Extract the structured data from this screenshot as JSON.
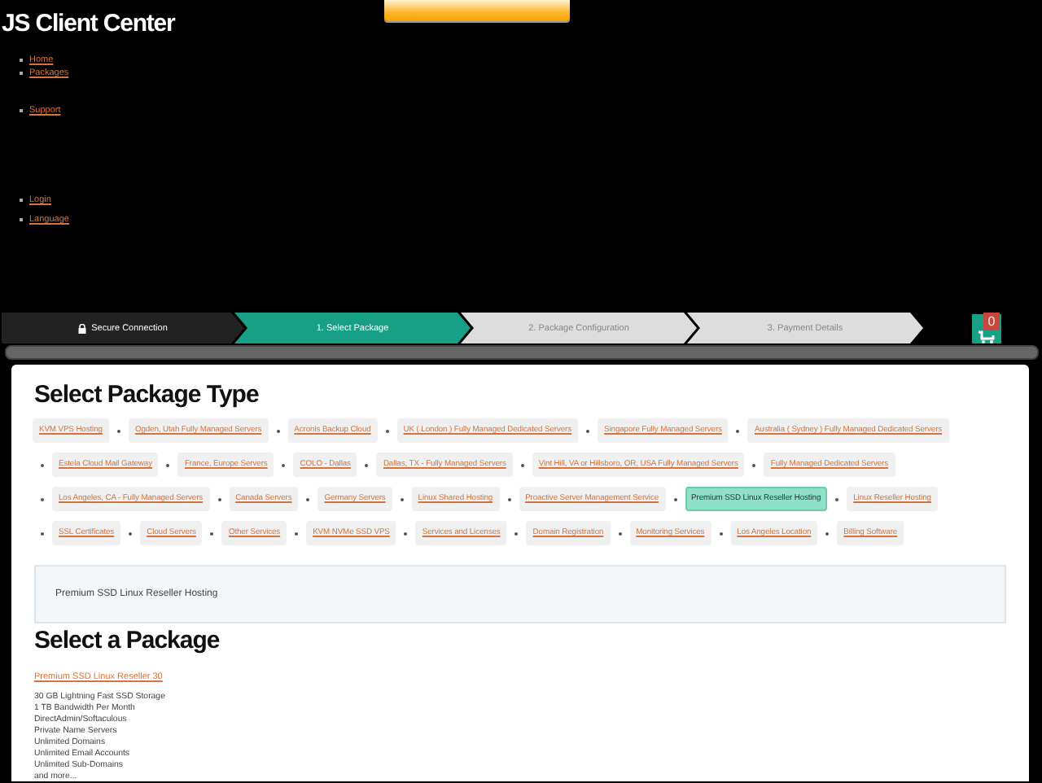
{
  "site": {
    "title": "JS Client Center"
  },
  "nav": [
    {
      "label": "Home"
    },
    {
      "label": "Packages"
    },
    {
      "label": "Support"
    },
    {
      "label": "Login"
    },
    {
      "label": "Language"
    }
  ],
  "steps": [
    {
      "label": "Secure Connection",
      "kind": "secure",
      "selected": false
    },
    {
      "label": "1. Select Package",
      "kind": "step",
      "selected": true
    },
    {
      "label": "2. Package Configuration",
      "kind": "step",
      "selected": false
    },
    {
      "label": "3. Payment Details",
      "kind": "step",
      "selected": false
    }
  ],
  "cart": {
    "count": "0"
  },
  "categories_heading": "Select Package Type",
  "categories": [
    {
      "label": "KVM VPS Hosting",
      "selected": false
    },
    {
      "label": "Ogden, Utah Fully Managed Servers",
      "selected": false
    },
    {
      "label": "Acronis Backup Cloud",
      "selected": false
    },
    {
      "label": "UK ( London ) Fully Managed Dedicated Servers",
      "selected": false
    },
    {
      "label": "Singapore Fully Managed Servers",
      "selected": false
    },
    {
      "label": "Australia ( Sydney ) Fully Managed Dedicated Servers",
      "selected": false
    },
    {
      "label": "Estela Cloud Mail Gateway",
      "selected": false
    },
    {
      "label": "France, Europe Servers",
      "selected": false
    },
    {
      "label": "COLO - Dallas",
      "selected": false
    },
    {
      "label": "Dallas, TX - Fully Managed Servers",
      "selected": false
    },
    {
      "label": "Vint Hill, VA or Hillsboro, OR, USA Fully Managed Servers",
      "selected": false
    },
    {
      "label": "Fully Managed Dedicated Servers",
      "selected": false
    },
    {
      "label": "Los Angeles, CA - Fully Managed Servers",
      "selected": false
    },
    {
      "label": "Canada Servers",
      "selected": false
    },
    {
      "label": "Germany Servers",
      "selected": false
    },
    {
      "label": "Linux Shared Hosting",
      "selected": false
    },
    {
      "label": "Proactive Server Management Service",
      "selected": false
    },
    {
      "label": "Premium SSD Linux Reseller Hosting",
      "selected": true
    },
    {
      "label": "Linux Reseller Hosting",
      "selected": false
    },
    {
      "label": "SSL Certificates",
      "selected": false
    },
    {
      "label": "Cloud Servers",
      "selected": false
    },
    {
      "label": "Other Services",
      "selected": false
    },
    {
      "label": "KVM NVMe SSD VPS",
      "selected": false
    },
    {
      "label": "Services and Licenses",
      "selected": false
    },
    {
      "label": "Domain Registration",
      "selected": false
    },
    {
      "label": "Monitoring Services",
      "selected": false
    },
    {
      "label": "Los Angeles Location",
      "selected": false
    },
    {
      "label": "Billing Software",
      "selected": false
    }
  ],
  "group_description": "Premium SSD Linux Reseller Hosting",
  "packages_heading": "Select a Package",
  "packages": [
    {
      "name": "Premium SSD Linux Reseller 30",
      "features": [
        "30 GB Lightning Fast SSD Storage",
        "1 TB Bandwidth Per Month",
        "DirectAdmin/Softaculous",
        "Private Name Servers",
        "Unlimited Domains",
        "Unlimited Email Accounts",
        "Unlimited Sub-Domains",
        "and more..."
      ]
    }
  ]
}
